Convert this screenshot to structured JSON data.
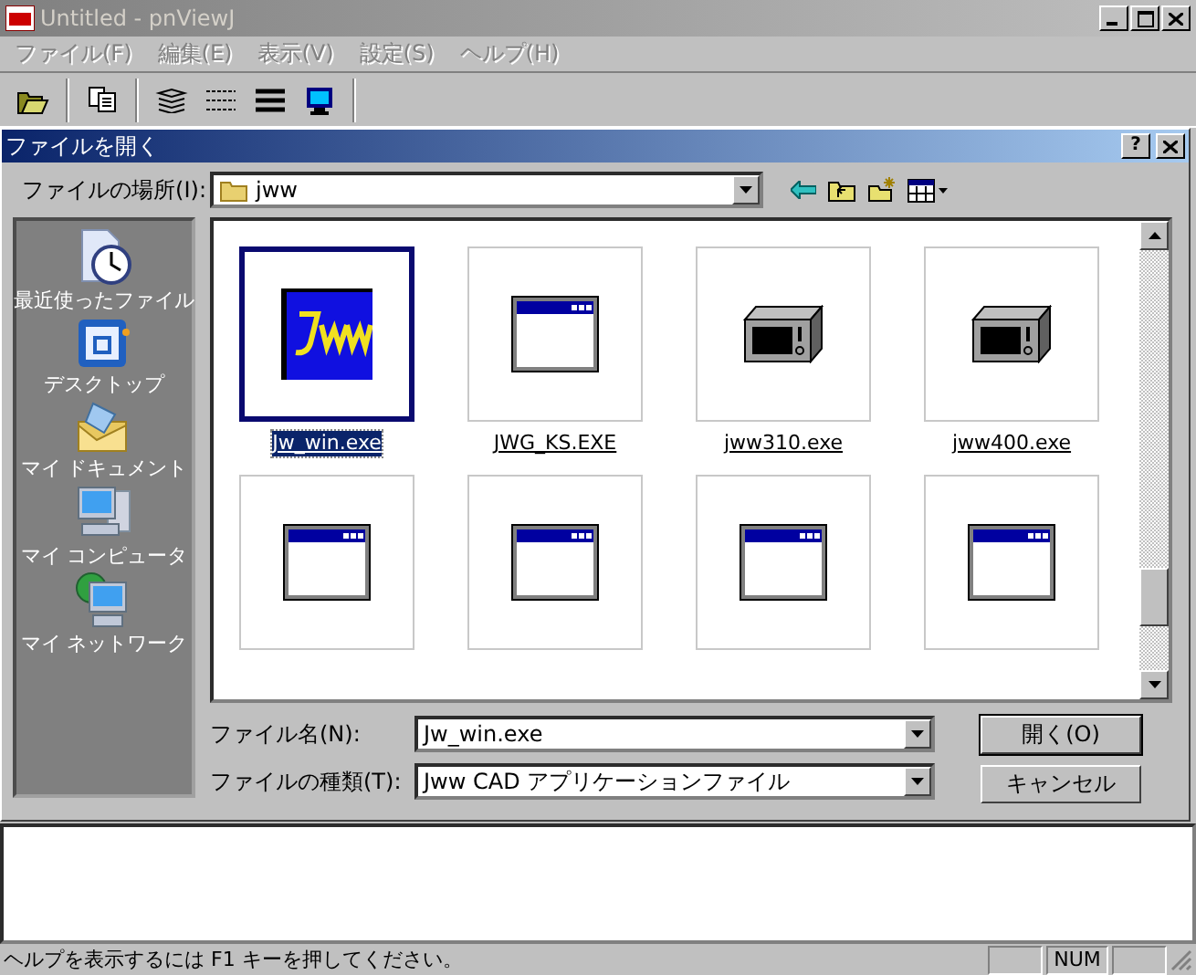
{
  "window": {
    "title": "Untitled - pnViewJ",
    "active": false
  },
  "menu": [
    {
      "label": "ファイル(F)"
    },
    {
      "label": "編集(E)"
    },
    {
      "label": "表示(V)"
    },
    {
      "label": "設定(S)"
    },
    {
      "label": "ヘルプ(H)"
    }
  ],
  "dialog": {
    "title": "ファイルを開く",
    "help_button": "?",
    "look_in": {
      "label": "ファイルの場所(I):",
      "value": "jww"
    },
    "places": [
      {
        "label": "最近使ったファイル",
        "kind": "recent"
      },
      {
        "label": "デスクトップ",
        "kind": "desktop"
      },
      {
        "label": "マイ ドキュメント",
        "kind": "documents"
      },
      {
        "label": "マイ コンピュータ",
        "kind": "computer"
      },
      {
        "label": "マイ ネットワーク",
        "kind": "network"
      }
    ],
    "files": [
      {
        "name": "Jw_win.exe",
        "kind": "jww",
        "selected": true
      },
      {
        "name": "JWG_KS.EXE",
        "kind": "window",
        "selected": false
      },
      {
        "name": "jww310.exe",
        "kind": "microwave",
        "selected": false
      },
      {
        "name": "jww400.exe",
        "kind": "microwave",
        "selected": false
      },
      {
        "kind": "window",
        "selected": false
      },
      {
        "kind": "window",
        "selected": false
      },
      {
        "kind": "window",
        "selected": false
      },
      {
        "kind": "window",
        "selected": false
      }
    ],
    "file_name": {
      "label": "ファイル名(N):",
      "value": "Jw_win.exe"
    },
    "file_type": {
      "label": "ファイルの種類(T):",
      "value": "Jww CAD アプリケーションファイル"
    },
    "buttons": [
      {
        "label": "開く(O)",
        "default": true
      },
      {
        "label": "キャンセル",
        "default": false
      }
    ]
  },
  "status_bar": {
    "message": "ヘルプを表示するには F1 キーを押してください。",
    "indicator": "NUM"
  }
}
